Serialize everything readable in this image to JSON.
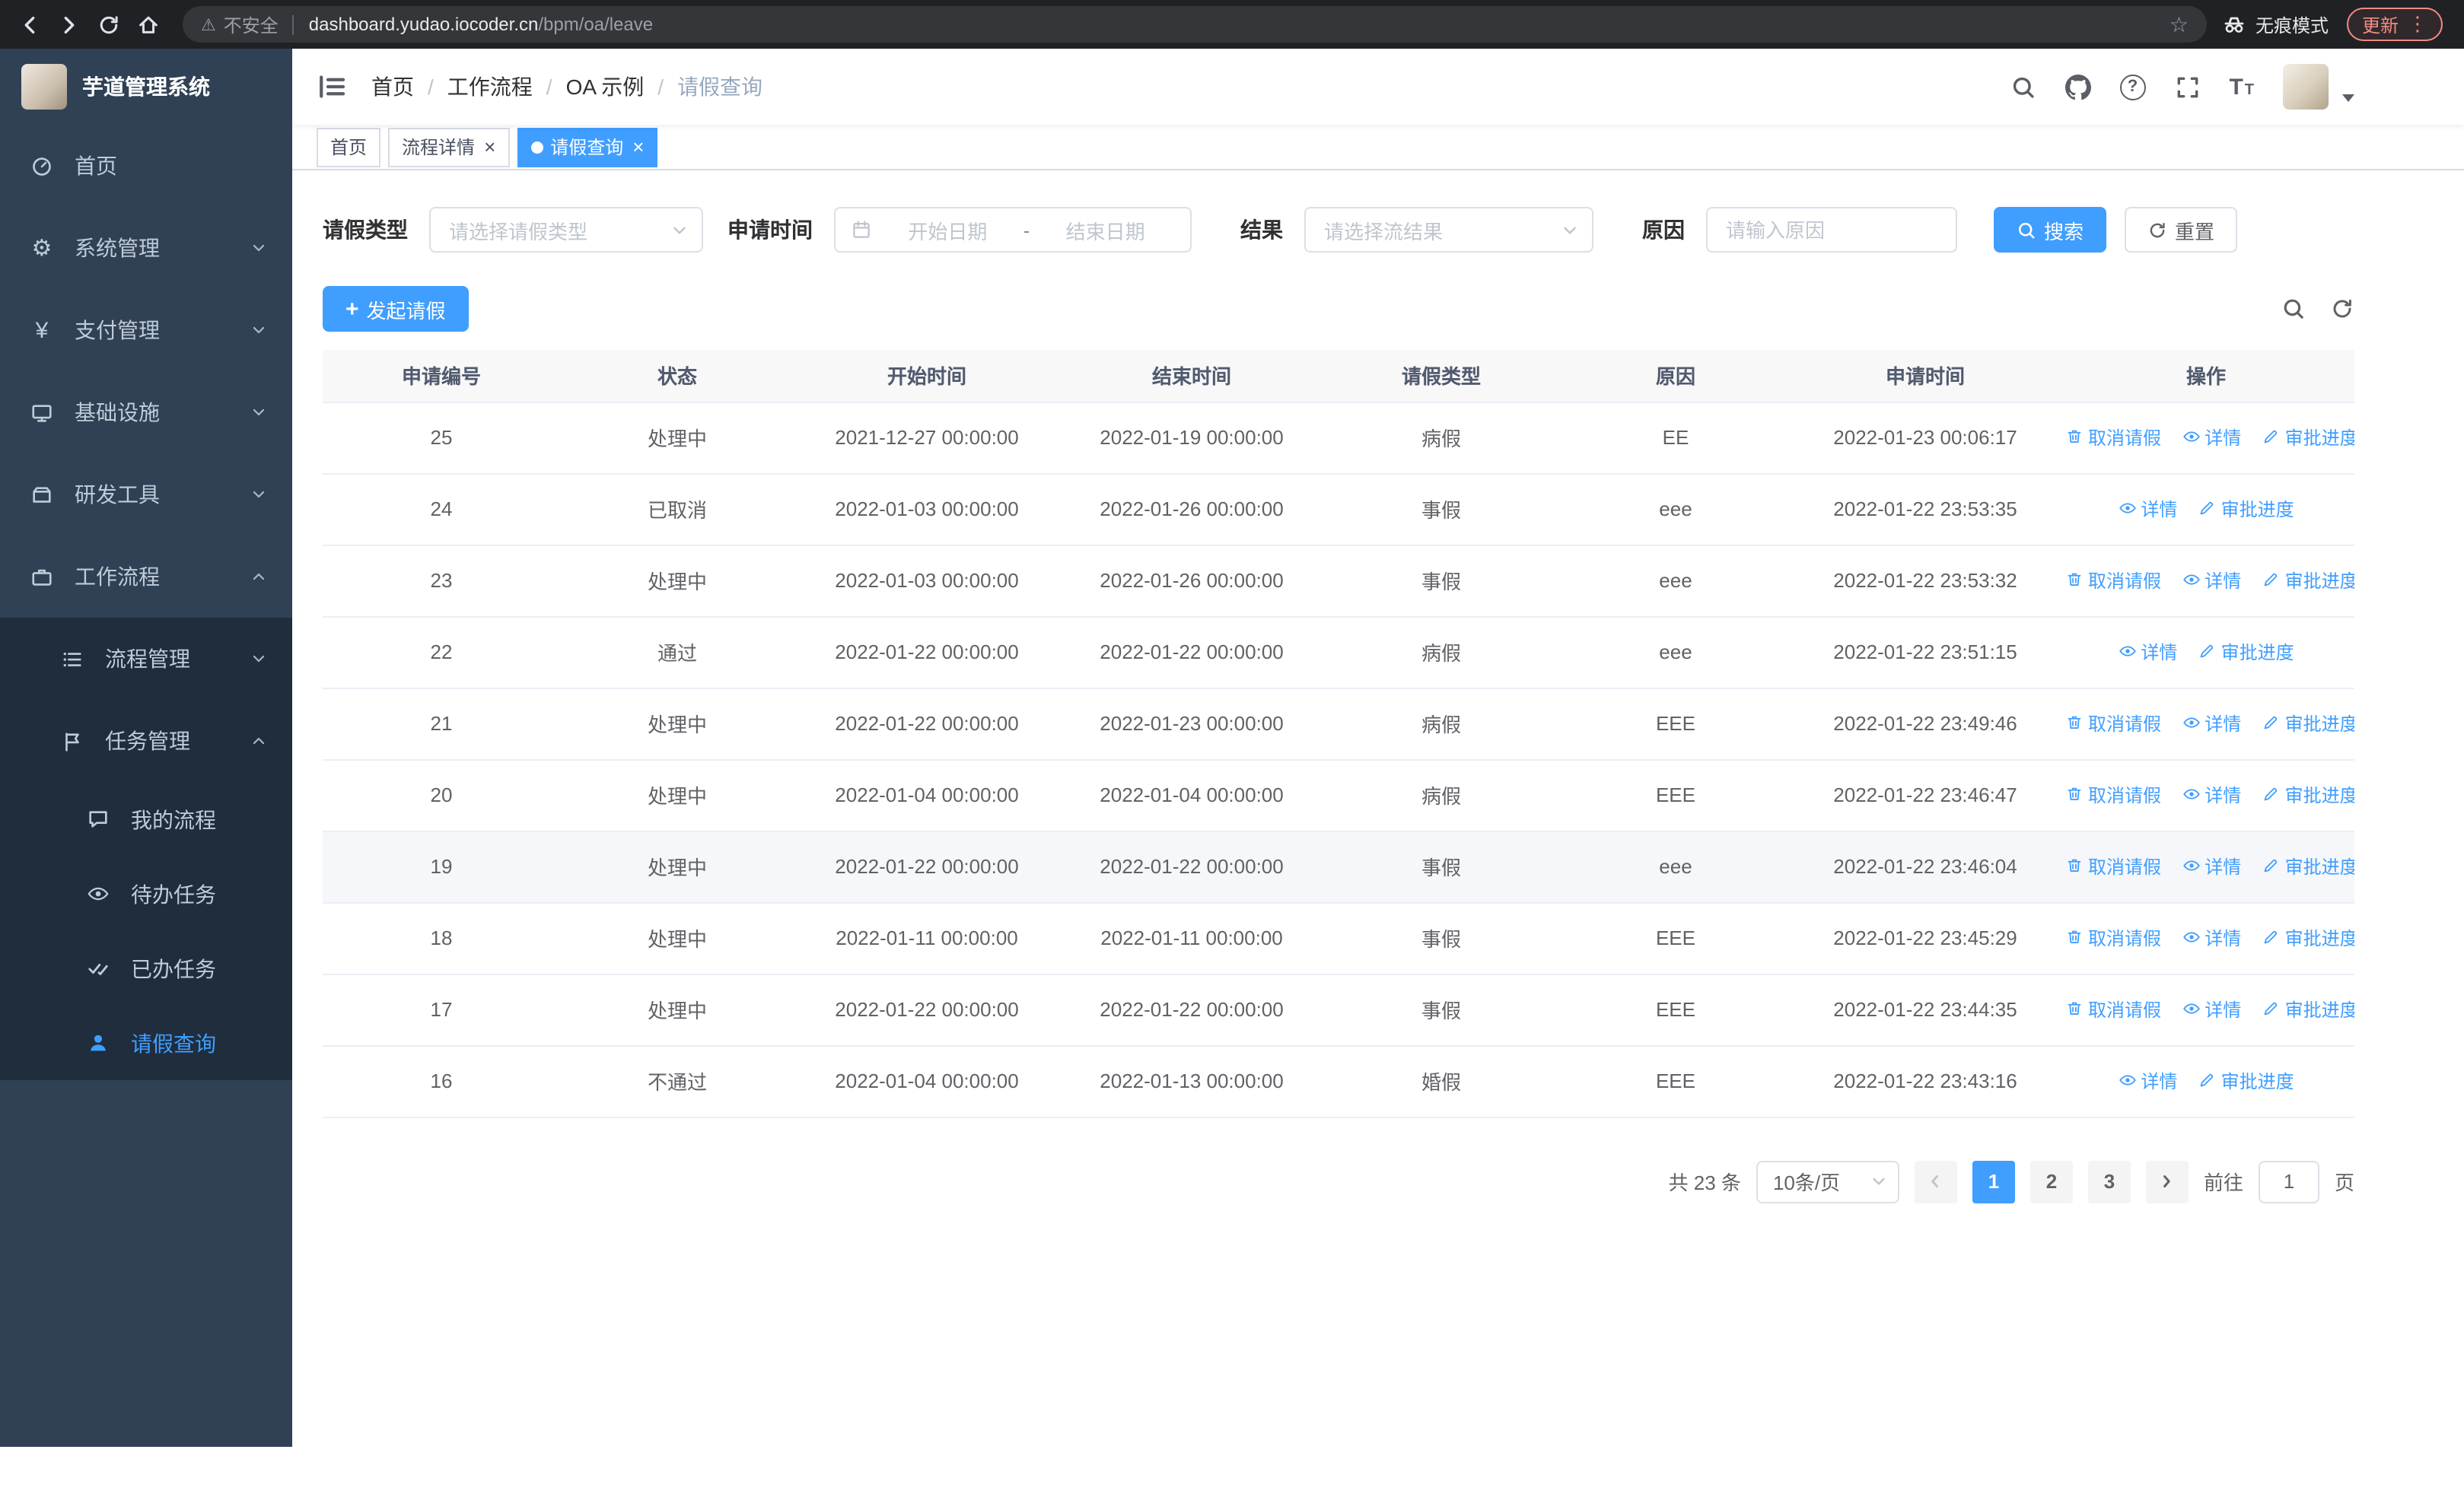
{
  "icons": {
    "warning": "⚠",
    "star": "☆",
    "dots": "⋮",
    "close": "×",
    "plus": "+",
    "help": "?",
    "font_size": "T",
    "gear": "⚙",
    "yen": "¥"
  },
  "colors": {
    "primary": "#409EFF",
    "sidebar_bg": "#304156",
    "submenu_bg": "#1f2d3d"
  },
  "browser": {
    "security_label": "不安全",
    "url_host": "dashboard.yudao.iocoder.cn",
    "url_path": "/bpm/oa/leave",
    "incognito_label": "无痕模式",
    "update_label": "更新"
  },
  "sidebar": {
    "app_title": "芋道管理系统",
    "items": [
      {
        "label": "首页"
      },
      {
        "label": "系统管理"
      },
      {
        "label": "支付管理"
      },
      {
        "label": "基础设施"
      },
      {
        "label": "研发工具"
      },
      {
        "label": "工作流程"
      },
      {
        "label": "流程管理"
      },
      {
        "label": "任务管理"
      },
      {
        "label": "我的流程"
      },
      {
        "label": "待办任务"
      },
      {
        "label": "已办任务"
      },
      {
        "label": "请假查询"
      }
    ]
  },
  "header": {
    "breadcrumb": [
      "首页",
      "工作流程",
      "OA 示例",
      "请假查询"
    ],
    "separator": "/"
  },
  "tabs": [
    {
      "label": "首页"
    },
    {
      "label": "流程详情"
    },
    {
      "label": "请假查询"
    }
  ],
  "filters": {
    "leave_type_label": "请假类型",
    "leave_type_placeholder": "请选择请假类型",
    "apply_time_label": "申请时间",
    "start_date_placeholder": "开始日期",
    "range_separator": "-",
    "end_date_placeholder": "结束日期",
    "result_label": "结果",
    "result_placeholder": "请选择流结果",
    "reason_label": "原因",
    "reason_placeholder": "请输入原因",
    "search_label": "搜索",
    "reset_label": "重置"
  },
  "toolbar": {
    "create_label": "发起请假"
  },
  "table": {
    "columns": [
      "申请编号",
      "状态",
      "开始时间",
      "结束时间",
      "请假类型",
      "原因",
      "申请时间",
      "操作"
    ],
    "action_labels": {
      "cancel": "取消请假",
      "detail": "详情",
      "progress": "审批进度"
    },
    "rows": [
      {
        "id": "25",
        "status": "处理中",
        "start": "2021-12-27 00:00:00",
        "end": "2022-01-19 00:00:00",
        "type": "病假",
        "reason": "EE",
        "applied": "2022-01-23 00:06:17"
      },
      {
        "id": "24",
        "status": "已取消",
        "start": "2022-01-03 00:00:00",
        "end": "2022-01-26 00:00:00",
        "type": "事假",
        "reason": "eee",
        "applied": "2022-01-22 23:53:35"
      },
      {
        "id": "23",
        "status": "处理中",
        "start": "2022-01-03 00:00:00",
        "end": "2022-01-26 00:00:00",
        "type": "事假",
        "reason": "eee",
        "applied": "2022-01-22 23:53:32"
      },
      {
        "id": "22",
        "status": "通过",
        "start": "2022-01-22 00:00:00",
        "end": "2022-01-22 00:00:00",
        "type": "病假",
        "reason": "eee",
        "applied": "2022-01-22 23:51:15"
      },
      {
        "id": "21",
        "status": "处理中",
        "start": "2022-01-22 00:00:00",
        "end": "2022-01-23 00:00:00",
        "type": "病假",
        "reason": "EEE",
        "applied": "2022-01-22 23:49:46"
      },
      {
        "id": "20",
        "status": "处理中",
        "start": "2022-01-04 00:00:00",
        "end": "2022-01-04 00:00:00",
        "type": "病假",
        "reason": "EEE",
        "applied": "2022-01-22 23:46:47"
      },
      {
        "id": "19",
        "status": "处理中",
        "start": "2022-01-22 00:00:00",
        "end": "2022-01-22 00:00:00",
        "type": "事假",
        "reason": "eee",
        "applied": "2022-01-22 23:46:04"
      },
      {
        "id": "18",
        "status": "处理中",
        "start": "2022-01-11 00:00:00",
        "end": "2022-01-11 00:00:00",
        "type": "事假",
        "reason": "EEE",
        "applied": "2022-01-22 23:45:29"
      },
      {
        "id": "17",
        "status": "处理中",
        "start": "2022-01-22 00:00:00",
        "end": "2022-01-22 00:00:00",
        "type": "事假",
        "reason": "EEE",
        "applied": "2022-01-22 23:44:35"
      },
      {
        "id": "16",
        "status": "不通过",
        "start": "2022-01-04 00:00:00",
        "end": "2022-01-13 00:00:00",
        "type": "婚假",
        "reason": "EEE",
        "applied": "2022-01-22 23:43:16"
      }
    ]
  },
  "pagination": {
    "total_label": "共 23 条",
    "page_size": "10条/页",
    "pages": [
      "1",
      "2",
      "3"
    ],
    "active_page": "1",
    "goto_label": "前往",
    "goto_value": "1",
    "unit_label": "页"
  }
}
